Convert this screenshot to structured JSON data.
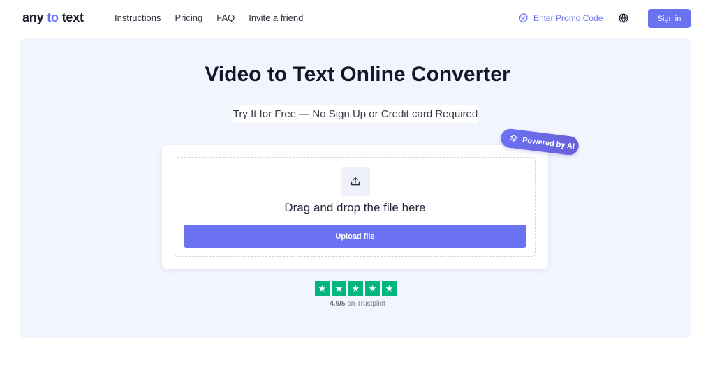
{
  "header": {
    "logo": {
      "part1": "any",
      "part2": "to",
      "part3": "text"
    },
    "nav": [
      {
        "label": "Instructions"
      },
      {
        "label": "Pricing"
      },
      {
        "label": "FAQ"
      },
      {
        "label": "Invite a friend"
      }
    ],
    "promo_label": "Enter Promo Code",
    "signin_label": "Sign in"
  },
  "hero": {
    "title": "Video to Text Online Converter",
    "subtitle": "Try It for Free — No Sign Up or Credit card Required",
    "badge": "Powered by AI"
  },
  "upload": {
    "drag_text": "Drag and drop the file here",
    "button_label": "Upload file"
  },
  "trust": {
    "score": "4.9/5",
    "suffix": "on Trustpilot",
    "stars": 5
  },
  "icons": {
    "promo": "badge-check-icon",
    "language": "globe-icon",
    "upload": "upload-icon",
    "badge": "layers-icon",
    "star": "star-icon"
  },
  "colors": {
    "accent": "#6b72f2",
    "hero_bg": "#f3f5fe",
    "trustpilot_green": "#00b67a",
    "text_dark": "#16162a"
  }
}
